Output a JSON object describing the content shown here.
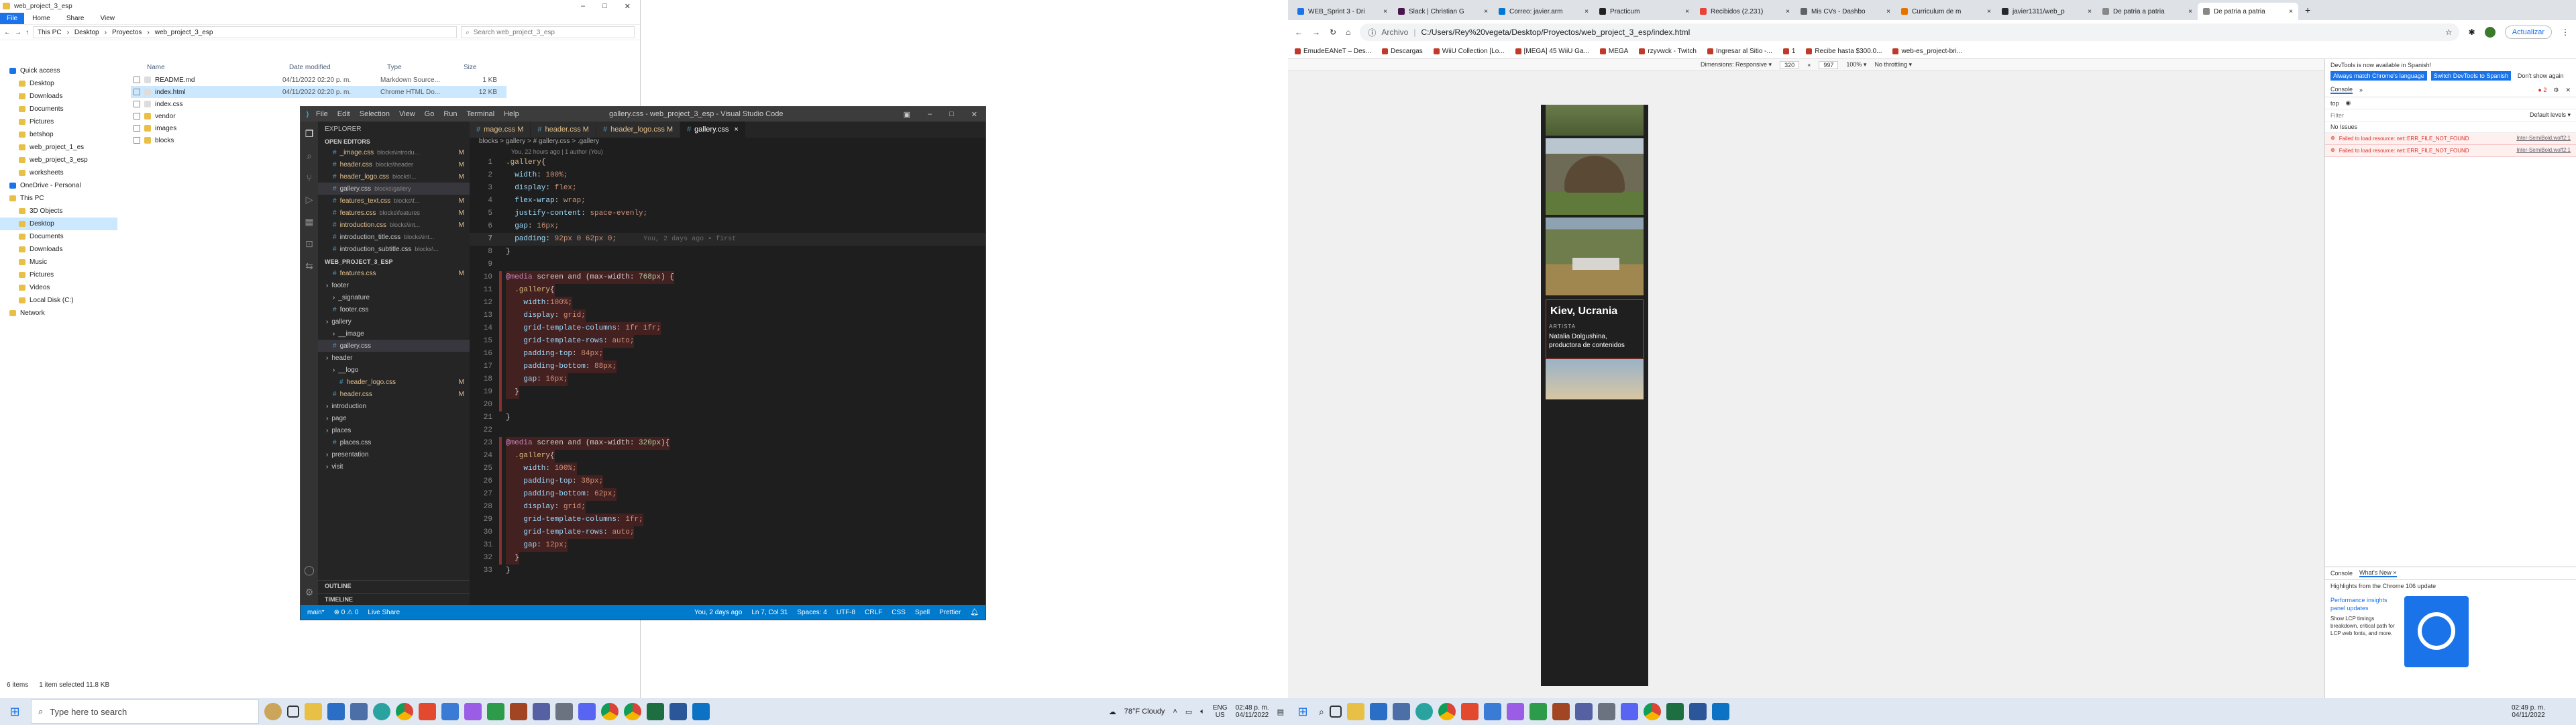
{
  "explorer": {
    "title": "web_project_3_esp",
    "tabs": [
      "File",
      "Home",
      "Share",
      "View"
    ],
    "breadcrumb": [
      "This PC",
      "Desktop",
      "Proyectos",
      "web_project_3_esp"
    ],
    "search_placeholder": "Search web_project_3_esp",
    "columns": [
      "Name",
      "Date modified",
      "Type",
      "Size"
    ],
    "files": [
      {
        "name": "README.md",
        "date": "04/11/2022 02:20 p. m.",
        "type": "Markdown Source...",
        "size": "1 KB"
      },
      {
        "name": "index.html",
        "date": "04/11/2022 02:20 p. m.",
        "type": "Chrome HTML Do...",
        "size": "12 KB"
      },
      {
        "name": "index.css",
        "date": "",
        "type": "",
        "size": ""
      },
      {
        "name": "vendor",
        "date": "",
        "type": "",
        "size": ""
      },
      {
        "name": "images",
        "date": "",
        "type": "",
        "size": ""
      },
      {
        "name": "blocks",
        "date": "",
        "type": "",
        "size": ""
      }
    ],
    "nav": [
      "Quick access",
      "Desktop",
      "Downloads",
      "Documents",
      "Pictures",
      "betshop",
      "web_project_1_es",
      "web_project_3_esp",
      "worksheets",
      "OneDrive - Personal",
      "This PC",
      "3D Objects",
      "Desktop",
      "Documents",
      "Downloads",
      "Music",
      "Pictures",
      "Videos",
      "Local Disk (C:)",
      "Network"
    ],
    "status_items": "6 items",
    "status_selected": "1 item selected  11.8 KB"
  },
  "vscode": {
    "title": "gallery.css - web_project_3_esp - Visual Studio Code",
    "menu": [
      "File",
      "Edit",
      "Selection",
      "View",
      "Go",
      "Run",
      "Terminal",
      "Help"
    ],
    "tabs": [
      {
        "label": "mage.css M",
        "active": false
      },
      {
        "label": "header.css M",
        "active": false
      },
      {
        "label": "header_logo.css M",
        "active": false
      },
      {
        "label": "gallery.css",
        "active": true
      }
    ],
    "explorer_label": "EXPLORER",
    "open_editors_label": "OPEN EDITORS",
    "open_editors": [
      {
        "name": "_image.css",
        "path": "blocks\\introdu...",
        "badge": "M"
      },
      {
        "name": "header.css",
        "path": "blocks\\header",
        "badge": "M"
      },
      {
        "name": "header_logo.css",
        "path": "blocks\\...",
        "badge": "M"
      },
      {
        "name": "gallery.css",
        "path": "blocks\\gallery",
        "badge": ""
      },
      {
        "name": "features_text.css",
        "path": "blocks\\f...",
        "badge": "M"
      },
      {
        "name": "features.css",
        "path": "blocks\\features",
        "badge": "M"
      },
      {
        "name": "introduction.css",
        "path": "blocks\\int...",
        "badge": "M"
      },
      {
        "name": "introduction_title.css",
        "path": "blocks\\int...",
        "badge": ""
      },
      {
        "name": "introduction_subtitle.css",
        "path": "blocks\\...",
        "badge": ""
      }
    ],
    "project_label": "WEB_PROJECT_3_ESP",
    "tree": [
      {
        "label": "features.css",
        "indent": 1,
        "badge": "M"
      },
      {
        "label": "footer",
        "indent": 0,
        "badge": ""
      },
      {
        "label": "_signature",
        "indent": 1,
        "badge": ""
      },
      {
        "label": "footer.css",
        "indent": 1,
        "badge": ""
      },
      {
        "label": "gallery",
        "indent": 0,
        "badge": ""
      },
      {
        "label": "__image",
        "indent": 1,
        "badge": ""
      },
      {
        "label": "gallery.css",
        "indent": 1,
        "badge": ""
      },
      {
        "label": "header",
        "indent": 0,
        "badge": ""
      },
      {
        "label": "__logo",
        "indent": 1,
        "badge": ""
      },
      {
        "label": "header_logo.css",
        "indent": 2,
        "badge": "M"
      },
      {
        "label": "header.css",
        "indent": 1,
        "badge": "M"
      },
      {
        "label": "introduction",
        "indent": 0,
        "badge": ""
      },
      {
        "label": "page",
        "indent": 0,
        "badge": ""
      },
      {
        "label": "places",
        "indent": 0,
        "badge": ""
      },
      {
        "label": "places.css",
        "indent": 1,
        "badge": ""
      },
      {
        "label": "presentation",
        "indent": 0,
        "badge": ""
      },
      {
        "label": "visit",
        "indent": 0,
        "badge": ""
      }
    ],
    "outline_label": "OUTLINE",
    "timeline_label": "TIMELINE",
    "crumbs": "blocks > gallery > # gallery.css > .gallery",
    "blame": "You, 22 hours ago | 1 author (You)",
    "code": [
      ".gallery{",
      "  width: 100%;",
      "  display: flex;",
      "  flex-wrap: wrap;",
      "  justify-content: space-evenly;",
      "  gap: 16px;",
      "  padding: 92px 0 62px 0;",
      "}",
      "",
      "@media screen and (max-width: 768px) {",
      "  .gallery{",
      "    width:100%;",
      "    display: grid;",
      "    grid-template-columns: 1fr 1fr;",
      "    grid-template-rows: auto;",
      "    padding-top: 84px;",
      "    padding-bottom: 88px;",
      "    gap: 16px;",
      "  }",
      "",
      "}",
      "",
      "@media screen and (max-width: 320px){",
      "  .gallery{",
      "    width: 100%;",
      "    padding-top: 38px;",
      "    padding-bottom: 62px;",
      "    display: grid;",
      "    grid-template-columns: 1fr;",
      "    grid-template-rows: auto;",
      "    gap: 12px;",
      "  }",
      "}"
    ],
    "inline_blame": "You, 2 days ago • first",
    "status_left": [
      "main*",
      "⊗ 0 ⚠ 0",
      "Live Share"
    ],
    "status_right": [
      "You, 2 days ago",
      "Ln 7, Col 31",
      "Spaces: 4",
      "UTF-8",
      "CRLF",
      "CSS",
      "Spell",
      "Prettier"
    ]
  },
  "taskbar": {
    "search_placeholder": "Type here to search",
    "weather": "78°F  Cloudy",
    "lang": "ENG\nUS",
    "time": "02:48 p. m.",
    "date": "04/11/2022",
    "time2": "02:49 p. m.",
    "date2": "04/11/2022"
  },
  "chrome": {
    "tabs": [
      "WEB_Sprint 3 - Dri",
      "Slack | Christian G",
      "Correo: javier.arm",
      "Practicum",
      "Recibidos (2.231)",
      "Mis CVs - Dashbo",
      "Curriculum de m",
      "javier1311/web_p",
      "De patria a patria",
      "De patria a patria"
    ],
    "address_prefix": "Archivo",
    "address": "C:/Users/Rey%20vegeta/Desktop/Proyectos/web_project_3_esp/index.html",
    "update_label": "Actualizar",
    "bookmarks": [
      "EmudeEANeT – Des...",
      "Descargas",
      "WiiU Collection [Lo...",
      "[MEGA] 45 WiiU Ga...",
      "MEGA",
      "rzyvwck - Twitch",
      "Ingresar al Sitio -...",
      "1",
      "Recibe hasta $300.0...",
      "web-es_project-bri..."
    ],
    "device_toolbar": [
      "Dimensions: Responsive ▾",
      "320",
      "×",
      "997",
      "100% ▾",
      "No throttling ▾"
    ],
    "card_title": "Kiev, Ucrania",
    "card_role": "ARTISTA",
    "card_name": "Natalia Dolgushina, productora de contenidos",
    "devtools": {
      "banner": "DevTools is now available in Spanish!",
      "btn1": "Always match Chrome's language",
      "btn2": "Switch DevTools to Spanish",
      "btn3": "Don't show again",
      "tabs": [
        "Console",
        "»"
      ],
      "context": "top",
      "filter_placeholder": "Filter",
      "levels": "Default levels ▾",
      "issues": "No Issues",
      "errors": [
        "Failed to load resource: net::ERR_FILE_NOT_FOUND",
        "Failed to load resource: net::ERR_FILE_NOT_FOUND"
      ],
      "err_link": "Inter-SemiBold.woff2:1",
      "bottom_tabs": [
        "Console",
        "What's New ×"
      ],
      "whats_new": "Highlights from the Chrome 106 update",
      "perf_title": "Performance insights panel updates",
      "perf_body": "Show LCP timings breakdown, critical path for LCP web fonts, and more."
    }
  }
}
